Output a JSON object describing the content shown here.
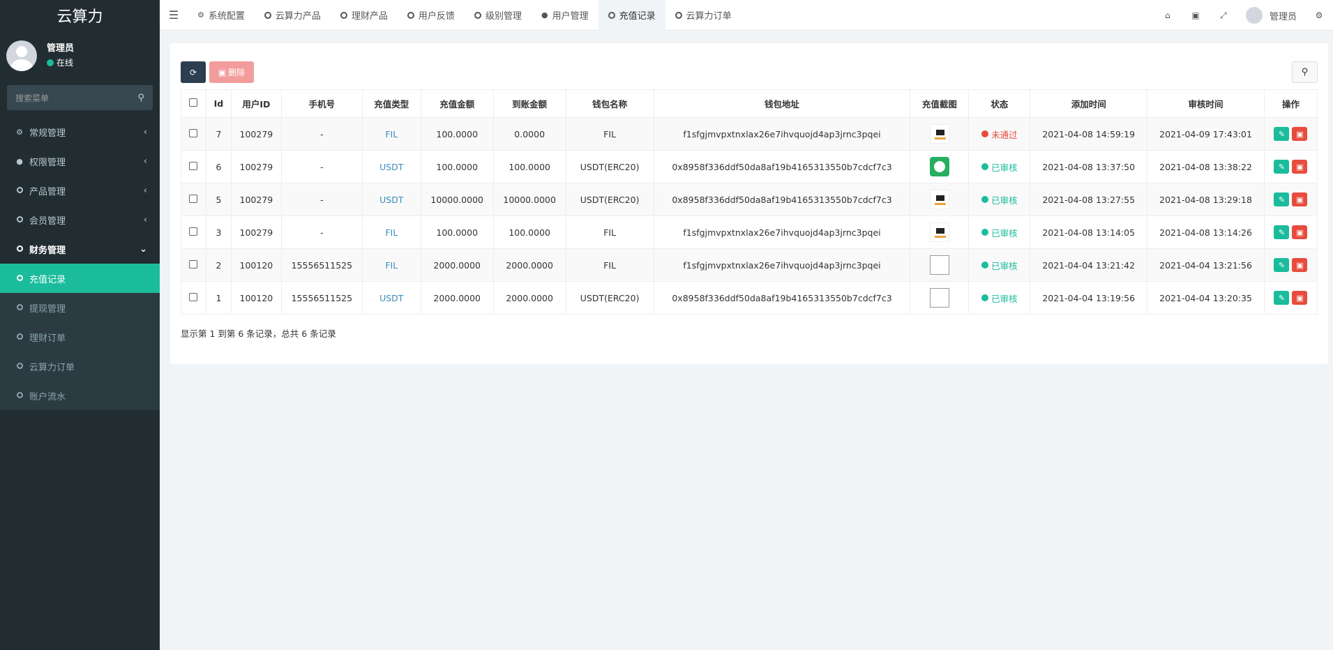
{
  "app": {
    "title": "云算力"
  },
  "user": {
    "name": "管理员",
    "status": "在线"
  },
  "sidebar": {
    "search_placeholder": "搜索菜单",
    "menu": [
      {
        "label": "常规管理"
      },
      {
        "label": "权限管理"
      },
      {
        "label": "产品管理"
      },
      {
        "label": "会员管理"
      },
      {
        "label": "财务管理"
      }
    ],
    "finance_sub": [
      {
        "label": "充值记录"
      },
      {
        "label": "提现管理"
      },
      {
        "label": "理财订单"
      },
      {
        "label": "云算力订单"
      },
      {
        "label": "账户流水"
      }
    ]
  },
  "tabs": [
    {
      "label": "系统配置"
    },
    {
      "label": "云算力产品"
    },
    {
      "label": "理财产品"
    },
    {
      "label": "用户反馈"
    },
    {
      "label": "级别管理"
    },
    {
      "label": "用户管理"
    },
    {
      "label": "充值记录"
    },
    {
      "label": "云算力订单"
    }
  ],
  "topbar": {
    "user_name": "管理员"
  },
  "toolbar": {
    "delete_label": "删除"
  },
  "table": {
    "headers": [
      "Id",
      "用户ID",
      "手机号",
      "充值类型",
      "充值金额",
      "到账金额",
      "钱包名称",
      "钱包地址",
      "充值截图",
      "状态",
      "添加时间",
      "审核时间",
      "操作"
    ],
    "rows": [
      {
        "id": "7",
        "uid": "100279",
        "phone": "-",
        "type": "FIL",
        "amount": "100.0000",
        "received": "0.0000",
        "wallet": "FIL",
        "address": "f1sfgjmvpxtnxlax26e7ihvquojd4ap3jrnc3pqei",
        "thumb": "dark",
        "status": "未通过",
        "status_type": "rejected",
        "added": "2021-04-08 14:59:19",
        "reviewed": "2021-04-09 17:43:01"
      },
      {
        "id": "6",
        "uid": "100279",
        "phone": "-",
        "type": "USDT",
        "amount": "100.0000",
        "received": "100.0000",
        "wallet": "USDT(ERC20)",
        "address": "0x8958f336ddf50da8af19b4165313550b7cdcf7c3",
        "thumb": "green",
        "status": "已审核",
        "status_type": "approved",
        "added": "2021-04-08 13:37:50",
        "reviewed": "2021-04-08 13:38:22"
      },
      {
        "id": "5",
        "uid": "100279",
        "phone": "-",
        "type": "USDT",
        "amount": "10000.0000",
        "received": "10000.0000",
        "wallet": "USDT(ERC20)",
        "address": "0x8958f336ddf50da8af19b4165313550b7cdcf7c3",
        "thumb": "dark",
        "status": "已审核",
        "status_type": "approved",
        "added": "2021-04-08 13:27:55",
        "reviewed": "2021-04-08 13:29:18"
      },
      {
        "id": "3",
        "uid": "100279",
        "phone": "-",
        "type": "FIL",
        "amount": "100.0000",
        "received": "100.0000",
        "wallet": "FIL",
        "address": "f1sfgjmvpxtnxlax26e7ihvquojd4ap3jrnc3pqei",
        "thumb": "dark",
        "status": "已审核",
        "status_type": "approved",
        "added": "2021-04-08 13:14:05",
        "reviewed": "2021-04-08 13:14:26"
      },
      {
        "id": "2",
        "uid": "100120",
        "phone": "15556511525",
        "type": "FIL",
        "amount": "2000.0000",
        "received": "2000.0000",
        "wallet": "FIL",
        "address": "f1sfgjmvpxtnxlax26e7ihvquojd4ap3jrnc3pqei",
        "thumb": "broken",
        "status": "已审核",
        "status_type": "approved",
        "added": "2021-04-04 13:21:42",
        "reviewed": "2021-04-04 13:21:56"
      },
      {
        "id": "1",
        "uid": "100120",
        "phone": "15556511525",
        "type": "USDT",
        "amount": "2000.0000",
        "received": "2000.0000",
        "wallet": "USDT(ERC20)",
        "address": "0x8958f336ddf50da8af19b4165313550b7cdcf7c3",
        "thumb": "broken",
        "status": "已审核",
        "status_type": "approved",
        "added": "2021-04-04 13:19:56",
        "reviewed": "2021-04-04 13:20:35"
      }
    ]
  },
  "pagination": {
    "summary": "显示第 1 到第 6 条记录，总共 6 条记录"
  }
}
